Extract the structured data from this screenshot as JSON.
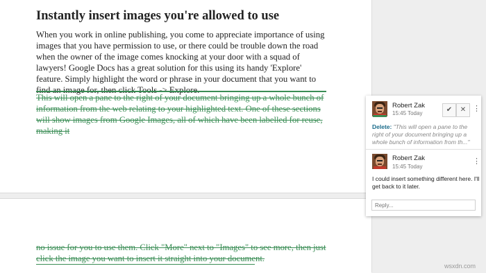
{
  "document": {
    "title": "Instantly insert images you're allowed to use",
    "paragraph": "When you work in online publishing, you come to appreciate importance of using images that you have permission to use, or there could be trouble down the road when the owner of the image comes knocking at your door with a squad of lawyers! Google Docs has a great solution for this using its handy 'Explore' feature. Simply highlight the word or phrase in your document that you want to find an image for, then click Tools -> Explore.",
    "deleted_text_page1": "This will open a pane to the right of your document bringing up a whole bunch of information from the web relating to your highlighted text. One of these sections will show images from Google Images, all of which have been labelled for reuse, making it",
    "deleted_text_page2": "no issue for you to use them. Click \"More\" next to \"Images\" to see more, then just click the image you want to insert it straight into your document."
  },
  "comment": {
    "author": "Robert Zak",
    "time": "15:45 Today",
    "resolve_icon": "checkmark-icon",
    "close_icon": "close-icon",
    "more_icon": "vertical-dots-icon",
    "delete_label": "Delete:",
    "delete_quote": "\"This will open a pane to the right of your document bringing up a whole bunch of information from th...\"",
    "reply_author": "Robert Zak",
    "reply_time": "15:45 Today",
    "reply_text": "I could insert something different here. I'll get back to it later.",
    "reply_placeholder": "Reply..."
  },
  "watermark": "wsxdn.com",
  "colors": {
    "suggestion_green": "#3a8d55",
    "delete_label_blue": "#1a6b8a"
  }
}
